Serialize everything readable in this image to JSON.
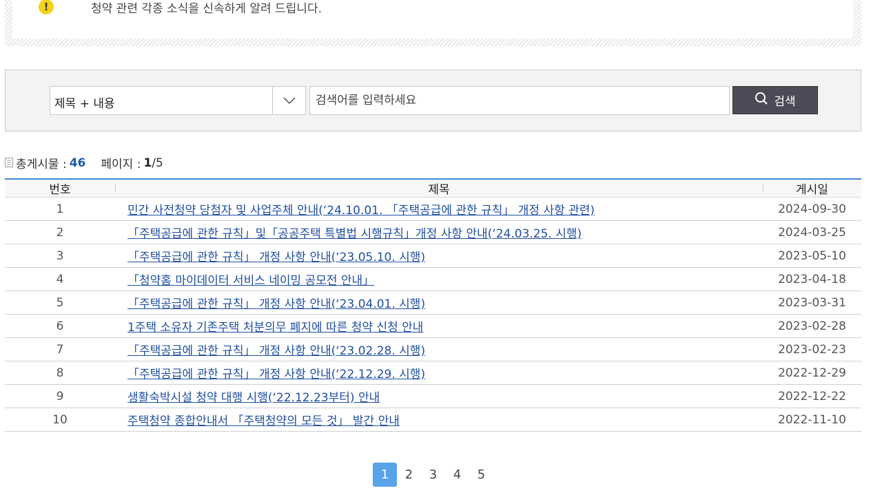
{
  "notice": {
    "icon": "exclamation-icon",
    "text": "청약 관련 각종 소식을 신속하게 알려 드립니다."
  },
  "search": {
    "select_value": "제목 + 내용",
    "placeholder": "검색어를 입력하세요",
    "button_label": "검색"
  },
  "summary": {
    "total_label": "총게시물 :",
    "total_count": "46",
    "page_label": "페이지 :",
    "current_page": "1",
    "total_pages": "/5"
  },
  "table": {
    "headers": {
      "num": "번호",
      "title": "제목",
      "date": "게시일"
    },
    "rows": [
      {
        "num": "1",
        "title": "민간 사전청약 당첨자 및 사업주체 안내(‘24.10.01. 「주택공급에 관한 규칙」 개정 사항 관련)",
        "date": "2024-09-30"
      },
      {
        "num": "2",
        "title": "「주택공급에 관한 규칙」및「공공주택 특별법 시행규칙」개정 사항 안내(‘24.03.25. 시행)",
        "date": "2024-03-25"
      },
      {
        "num": "3",
        "title": "「주택공급에 관한 규칙」 개정 사항 안내(‘23.05.10. 시행)",
        "date": "2023-05-10"
      },
      {
        "num": "4",
        "title": "「청약홈 마이데이터 서비스 네이밍 공모전 안내」",
        "date": "2023-04-18"
      },
      {
        "num": "5",
        "title": "「주택공급에 관한 규칙」 개정 사항 안내(‘23.04.01. 시행)",
        "date": "2023-03-31"
      },
      {
        "num": "6",
        "title": "1주택 소유자 기존주택 처분의무 폐지에 따른 청약 신청 안내",
        "date": "2023-02-28"
      },
      {
        "num": "7",
        "title": "「주택공급에 관한 규칙」 개정 사항 안내(‘23.02.28. 시행)",
        "date": "2023-02-23"
      },
      {
        "num": "8",
        "title": "「주택공급에 관한 규칙」 개정 사항 안내(‘22.12.29. 시행)",
        "date": "2022-12-29"
      },
      {
        "num": "9",
        "title": "생활숙박시설 청약 대행 시행(‘22.12.23부터) 안내",
        "date": "2022-12-22"
      },
      {
        "num": "10",
        "title": "주택청약 종합안내서 「주택청약의 모든 것」 발간 안내",
        "date": "2022-11-10"
      }
    ]
  },
  "pagination": {
    "pages": [
      "1",
      "2",
      "3",
      "4",
      "5"
    ],
    "active": "1"
  },
  "colors": {
    "accent": "#59a3ea",
    "link": "#1f4fa0",
    "search_button": "#4b4b57",
    "notice_icon": "#f5d11c"
  }
}
